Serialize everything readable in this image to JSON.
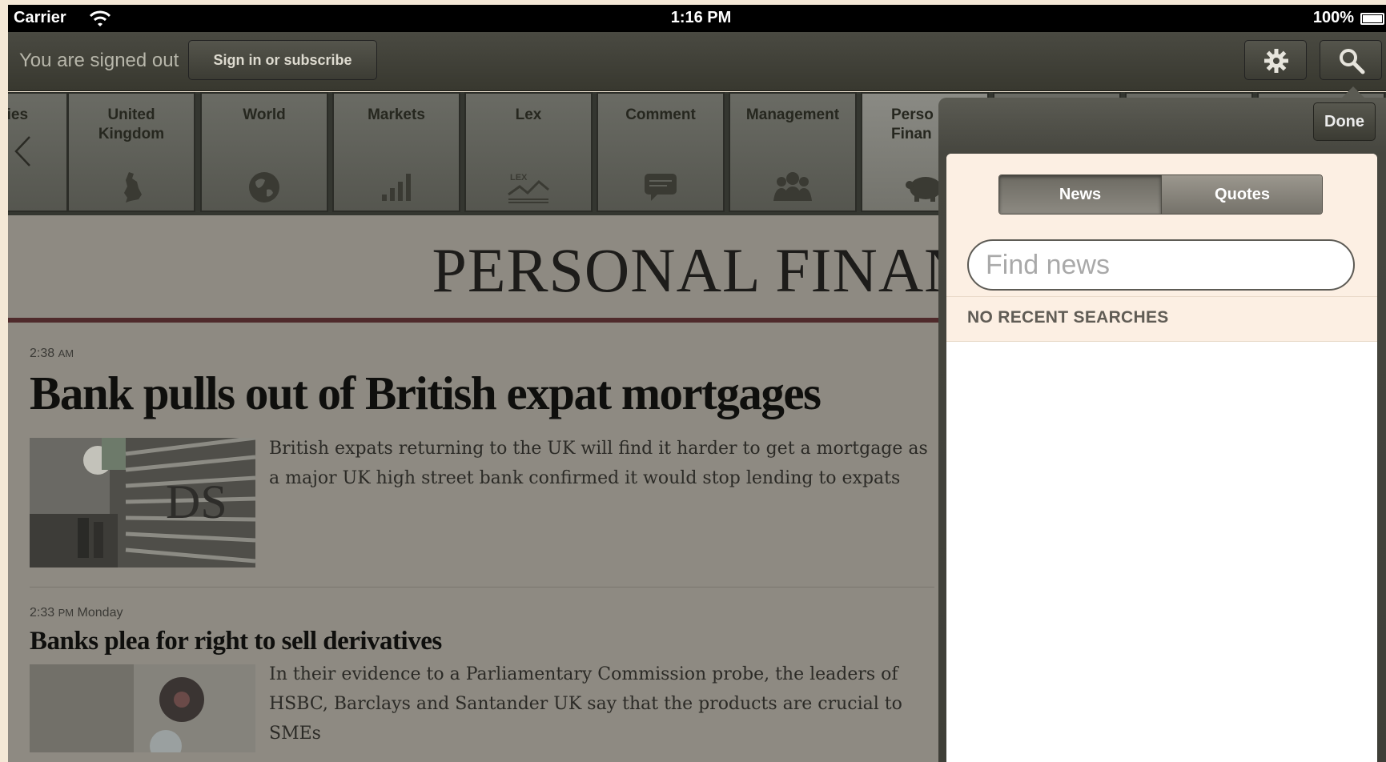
{
  "status_bar": {
    "carrier": "Carrier",
    "time": "1:16 PM",
    "battery": "100%"
  },
  "toolbar": {
    "signed_out_text": "You are signed out",
    "sign_in_label": "Sign in or subscribe"
  },
  "tabs": [
    {
      "label": "nies",
      "icon": "back-arrow-icon"
    },
    {
      "label": "United Kingdom",
      "icon": "uk-map-icon"
    },
    {
      "label": "World",
      "icon": "globe-icon"
    },
    {
      "label": "Markets",
      "icon": "bar-chart-icon"
    },
    {
      "label": "Lex",
      "icon": "lex-chart-icon"
    },
    {
      "label": "Comment",
      "icon": "speech-bubble-icon"
    },
    {
      "label": "Management",
      "icon": "people-icon"
    },
    {
      "label": "Perso Finan",
      "icon": "piggy-bank-icon",
      "active": true
    },
    {
      "label": "",
      "icon": ""
    },
    {
      "label": "",
      "icon": ""
    },
    {
      "label": "",
      "icon": ""
    }
  ],
  "section_title": "PERSONAL FINAN",
  "stories": [
    {
      "time": "2:38",
      "ampm": "AM",
      "day": "",
      "headline": "Bank pulls out of British expat mortgages",
      "summary": "British expats returning to the UK will find it harder to get a mortgage as a major UK high street bank confirmed it would stop lending to expats"
    },
    {
      "time": "2:33",
      "ampm": "PM",
      "day": "Monday",
      "headline": "Banks plea for right to sell derivatives",
      "summary": "In their evidence to a Parliamentary Commission probe, the leaders of HSBC, Barclays and Santander UK say that the products are crucial to SMEs"
    }
  ],
  "search_popover": {
    "done_label": "Done",
    "segments": [
      "News",
      "Quotes"
    ],
    "selected_segment": "News",
    "search_placeholder": "Find news",
    "search_value": "",
    "recent_label": "NO RECENT SEARCHES"
  },
  "colors": {
    "toolbar": "#3e3e36",
    "content_dimmed": "#8e8a82",
    "section_rule": "#4f2a2b",
    "popover_panel": "#fcefe3"
  }
}
